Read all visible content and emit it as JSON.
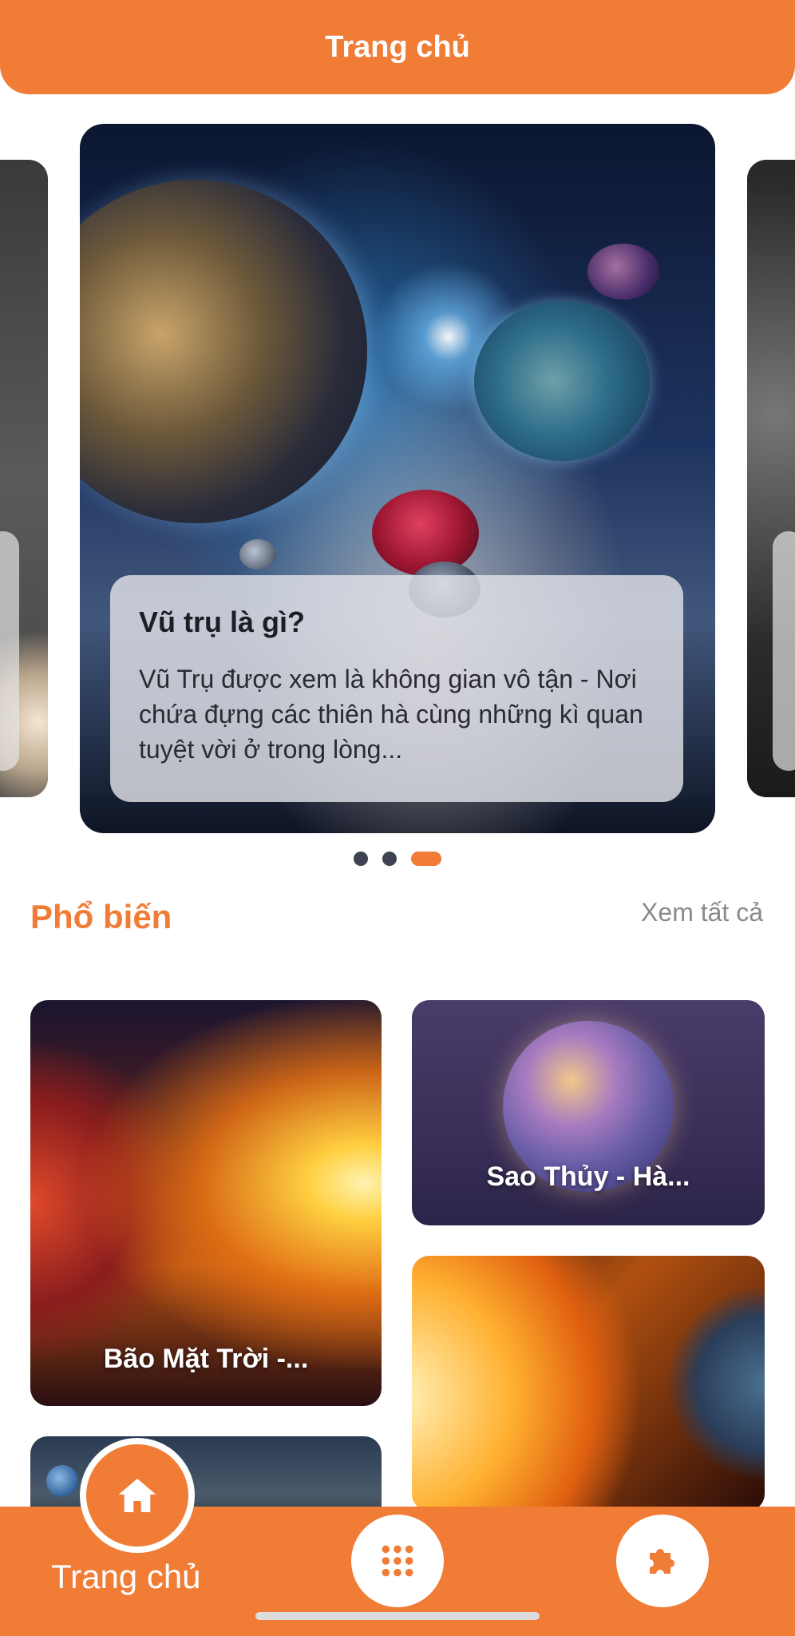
{
  "header": {
    "title": "Trang chủ"
  },
  "carousel": {
    "active_card": {
      "title": "Vũ trụ là gì?",
      "text": "Vũ Trụ được xem là không gian vô tận - Nơi chứa đựng các thiên hà cùng những kì quan tuyệt vời ở trong lòng..."
    },
    "page_count": 3,
    "active_index": 2
  },
  "popular": {
    "title": "Phổ biến",
    "see_all": "Xem tất cả",
    "items": [
      {
        "label": "Bão Mặt Trời -..."
      },
      {
        "label": "Sao Thủy - Hà..."
      },
      {
        "label": ""
      },
      {
        "label": ""
      }
    ]
  },
  "tabbar": {
    "home_label": "Trang chủ",
    "icons": [
      "home-icon",
      "grid-dots-icon",
      "puzzle-icon"
    ]
  },
  "colors": {
    "accent": "#F07C35",
    "dot_inactive": "#3d4350"
  }
}
